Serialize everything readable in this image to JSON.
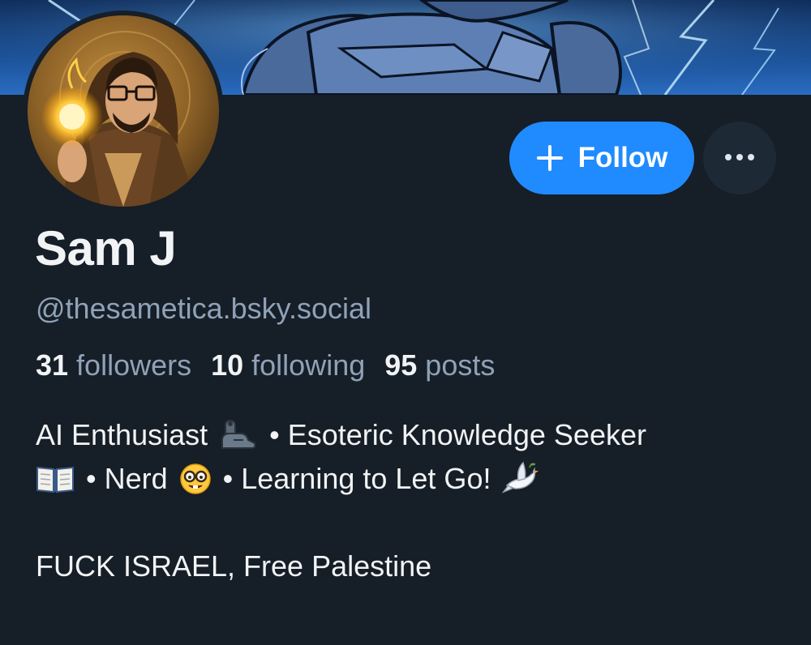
{
  "profile": {
    "display_name": "Sam J",
    "handle": "@thesametica.bsky.social",
    "avatar_icon": "avatar-wizard-icon",
    "banner_icon": "banner-armor-icon"
  },
  "actions": {
    "follow_label": "Follow",
    "follow_icon": "plus-icon",
    "more_icon": "ellipsis-icon",
    "accent_color": "#208bfe"
  },
  "stats": {
    "followers_count": "31",
    "followers_label": "followers",
    "following_count": "10",
    "following_label": "following",
    "posts_count": "95",
    "posts_label": "posts"
  },
  "bio": {
    "line1_part1": "AI Enthusiast",
    "line1_emoji": "flexed-biceps-mechanical-arm-icon",
    "line1_part2": "• Esoteric Knowledge Seeker",
    "line2_emoji1": "open-book-icon",
    "line2_part1": "• Nerd",
    "line2_emoji2": "nerd-face-icon",
    "line2_part2": "• Learning to Let Go!",
    "line2_emoji3": "dove-icon",
    "line3": "FUCK ISRAEL, Free Palestine"
  }
}
